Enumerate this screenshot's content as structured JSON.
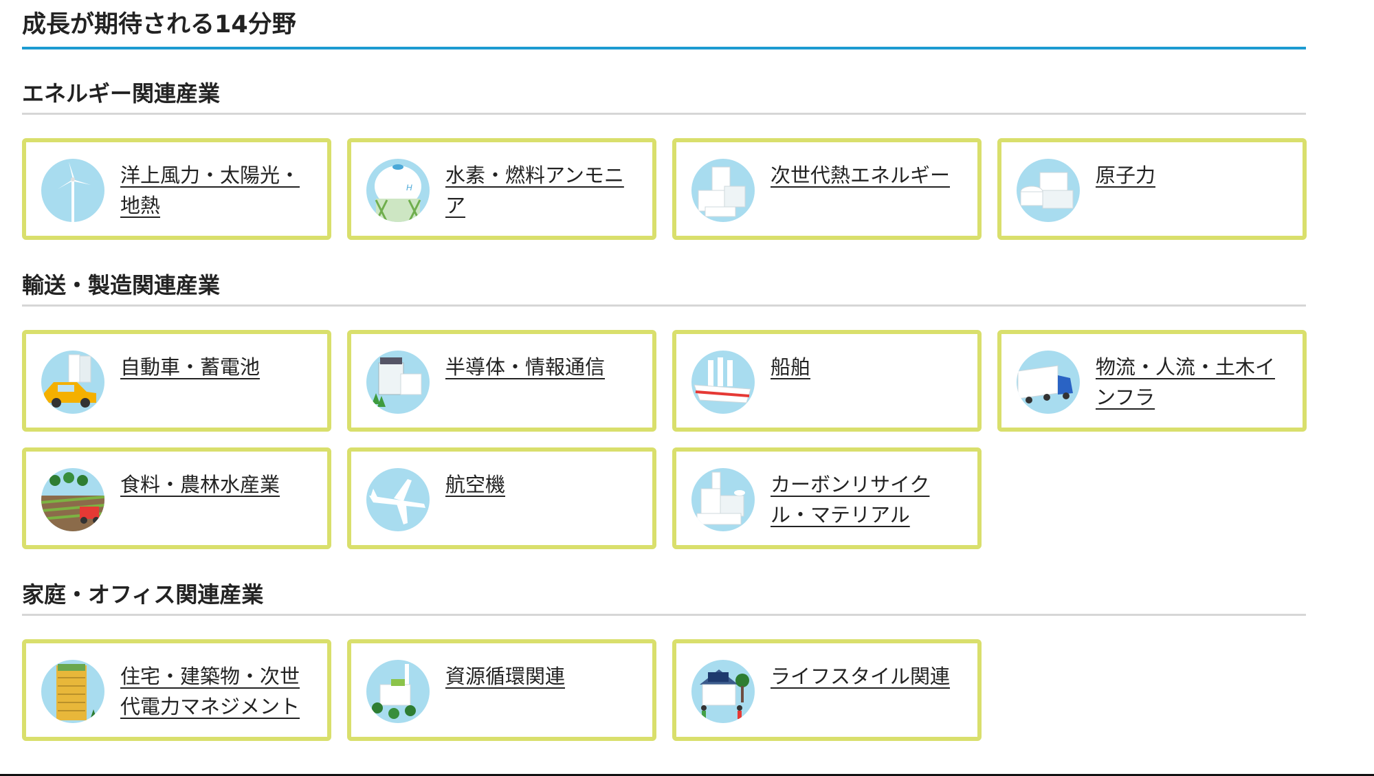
{
  "page": {
    "title": "成長が期待される14分野"
  },
  "sections": [
    {
      "title": "エネルギー関連産業",
      "items": [
        {
          "label": "洋上風力・太陽光・地熱",
          "icon": "wind-turbine-icon"
        },
        {
          "label": "水素・燃料アンモニア",
          "icon": "hydrogen-tank-icon"
        },
        {
          "label": "次世代熱エネルギー",
          "icon": "heat-plant-icon"
        },
        {
          "label": "原子力",
          "icon": "nuclear-plant-icon"
        }
      ]
    },
    {
      "title": "輸送・製造関連産業",
      "items": [
        {
          "label": "自動車・蓄電池",
          "icon": "car-battery-icon"
        },
        {
          "label": "半導体・情報通信",
          "icon": "semiconductor-building-icon"
        },
        {
          "label": "船舶",
          "icon": "ship-icon"
        },
        {
          "label": "物流・人流・土木インフラ",
          "icon": "truck-icon"
        },
        {
          "label": "食料・農林水産業",
          "icon": "farm-tractor-icon"
        },
        {
          "label": "航空機",
          "icon": "airplane-icon"
        },
        {
          "label": "カーボンリサイクル・マテリアル",
          "icon": "recycle-factory-icon"
        }
      ]
    },
    {
      "title": "家庭・オフィス関連産業",
      "items": [
        {
          "label": "住宅・建築物・次世代電力マネジメント",
          "icon": "green-building-icon"
        },
        {
          "label": "資源循環関連",
          "icon": "recycling-plant-icon"
        },
        {
          "label": "ライフスタイル関連",
          "icon": "solar-house-icon"
        }
      ]
    }
  ],
  "colors": {
    "accent_line": "#1c9bd1",
    "card_border": "#d9df6c",
    "icon_bg": "#a8dcef"
  }
}
